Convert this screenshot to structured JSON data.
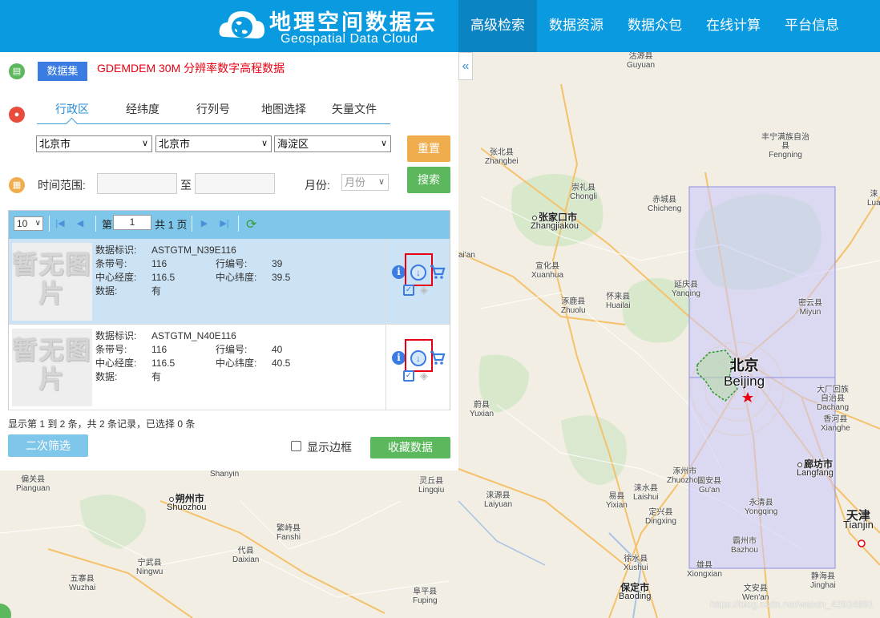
{
  "header": {
    "logo_title": "地理空间数据云",
    "logo_subtitle": "Geospatial Data Cloud",
    "nav": [
      "高级检索",
      "数据资源",
      "数据众包",
      "在线计算",
      "平台信息"
    ],
    "active_nav": 0
  },
  "panel": {
    "dataset_button": "数据集",
    "dataset_name": "GDEMDEM 30M 分辨率数字高程数据",
    "tabs": [
      "行政区",
      "经纬度",
      "行列号",
      "地图选择",
      "矢量文件"
    ],
    "active_tab": 0,
    "province": "北京市",
    "city": "北京市",
    "district": "海淀区",
    "reset_button": "重置",
    "search_button": "搜索",
    "time_label": "时间范围:",
    "time_to": "至",
    "month_label": "月份:",
    "month_placeholder": "月份",
    "collapse_icon": "«"
  },
  "grid": {
    "page_size": "10",
    "page_prefix": "第",
    "page_value": "1",
    "page_suffix": "共 1 页",
    "thumb_text": "暂无图片",
    "labels": {
      "id": "数据标识:",
      "path": "条带号:",
      "row": "行编号:",
      "lon": "中心经度:",
      "lat": "中心纬度:",
      "data": "数据:"
    },
    "items": [
      {
        "id": "ASTGTM_N39E116",
        "path": "116",
        "row": "39",
        "lon": "116.5",
        "lat": "39.5",
        "data": "有",
        "selected": true
      },
      {
        "id": "ASTGTM_N40E116",
        "path": "116",
        "row": "40",
        "lon": "116.5",
        "lat": "40.5",
        "data": "有",
        "selected": false
      }
    ],
    "summary": "显示第 1 到 2 条，共 2 条记录，已选择 0 条"
  },
  "footer": {
    "filter_button": "二次筛选",
    "border_checkbox_label": "显示边框",
    "border_checked": false,
    "favorite_button": "收藏数据"
  },
  "map": {
    "watermark": "https://blog.csdn.net/weixin_42924891",
    "cities": [
      {
        "zh": "沽源县",
        "en": "Guyuan"
      },
      {
        "zh": "张北县",
        "en": "Zhangbei"
      },
      {
        "zh": "丰宁满族自治县",
        "en": "Fengning"
      },
      {
        "zh": "崇礼县",
        "en": "Chongli"
      },
      {
        "zh": "赤城县",
        "en": "Chicheng"
      },
      {
        "zh": "张家口市",
        "en": "Zhangjiakou"
      },
      {
        "zh": "宣化县",
        "en": "Xuanhua"
      },
      {
        "zh": "延庆县",
        "en": "Yanqing"
      },
      {
        "zh": "怀来县",
        "en": "Huailai"
      },
      {
        "zh": "涿鹿县",
        "en": "Zhuolu"
      },
      {
        "zh": "密云县",
        "en": "Miyun"
      },
      {
        "zh": "北京",
        "en": "Beijing"
      },
      {
        "zh": "蔚县",
        "en": "Yuxian"
      },
      {
        "zh": "大厂回族自治县",
        "en": "Dachang"
      },
      {
        "zh": "香河县",
        "en": "Xianghe"
      },
      {
        "zh": "涿州市",
        "en": "Zhuozhou"
      },
      {
        "zh": "廊坊市",
        "en": "Langfang"
      },
      {
        "zh": "涞源县",
        "en": "Laiyuan"
      },
      {
        "zh": "易县",
        "en": "Yixian"
      },
      {
        "zh": "涞水县",
        "en": "Laishui"
      },
      {
        "zh": "固安县",
        "en": "Gu'an"
      },
      {
        "zh": "永清县",
        "en": "Yongqing"
      },
      {
        "zh": "定兴县",
        "en": "Dingxing"
      },
      {
        "zh": "霸州市",
        "en": "Bazhou"
      },
      {
        "zh": "天津",
        "en": "Tianjin"
      },
      {
        "zh": "徐水县",
        "en": "Xushui"
      },
      {
        "zh": "雄县",
        "en": "Xiongxian"
      },
      {
        "zh": "静海县",
        "en": "Jinghai"
      },
      {
        "zh": "保定市",
        "en": "Baoding"
      },
      {
        "zh": "文安县",
        "en": "Wen'an"
      },
      {
        "zh": "偏关县",
        "en": "Pianguan"
      },
      {
        "zh": "朔州市",
        "en": "Shuozhou"
      },
      {
        "zh": "灵丘县",
        "en": "Lingqiu"
      },
      {
        "zh": "繁峙县",
        "en": "Fanshi"
      },
      {
        "zh": "代县",
        "en": "Daixian"
      },
      {
        "zh": "宁武县",
        "en": "Ningwu"
      },
      {
        "zh": "五寨县",
        "en": "Wuzhai"
      },
      {
        "zh": "阜平县",
        "en": "Fuping"
      },
      {
        "zh": "涞",
        "en": "Lua"
      },
      {
        "zh": "",
        "en": "Shanyin"
      },
      {
        "zh": "",
        "en": "ai'an"
      }
    ]
  },
  "colors": {
    "header": "#0a9ae0",
    "accent": "#3a7ce2",
    "highlight": "#e60012",
    "tile": "#c8c8ff"
  }
}
